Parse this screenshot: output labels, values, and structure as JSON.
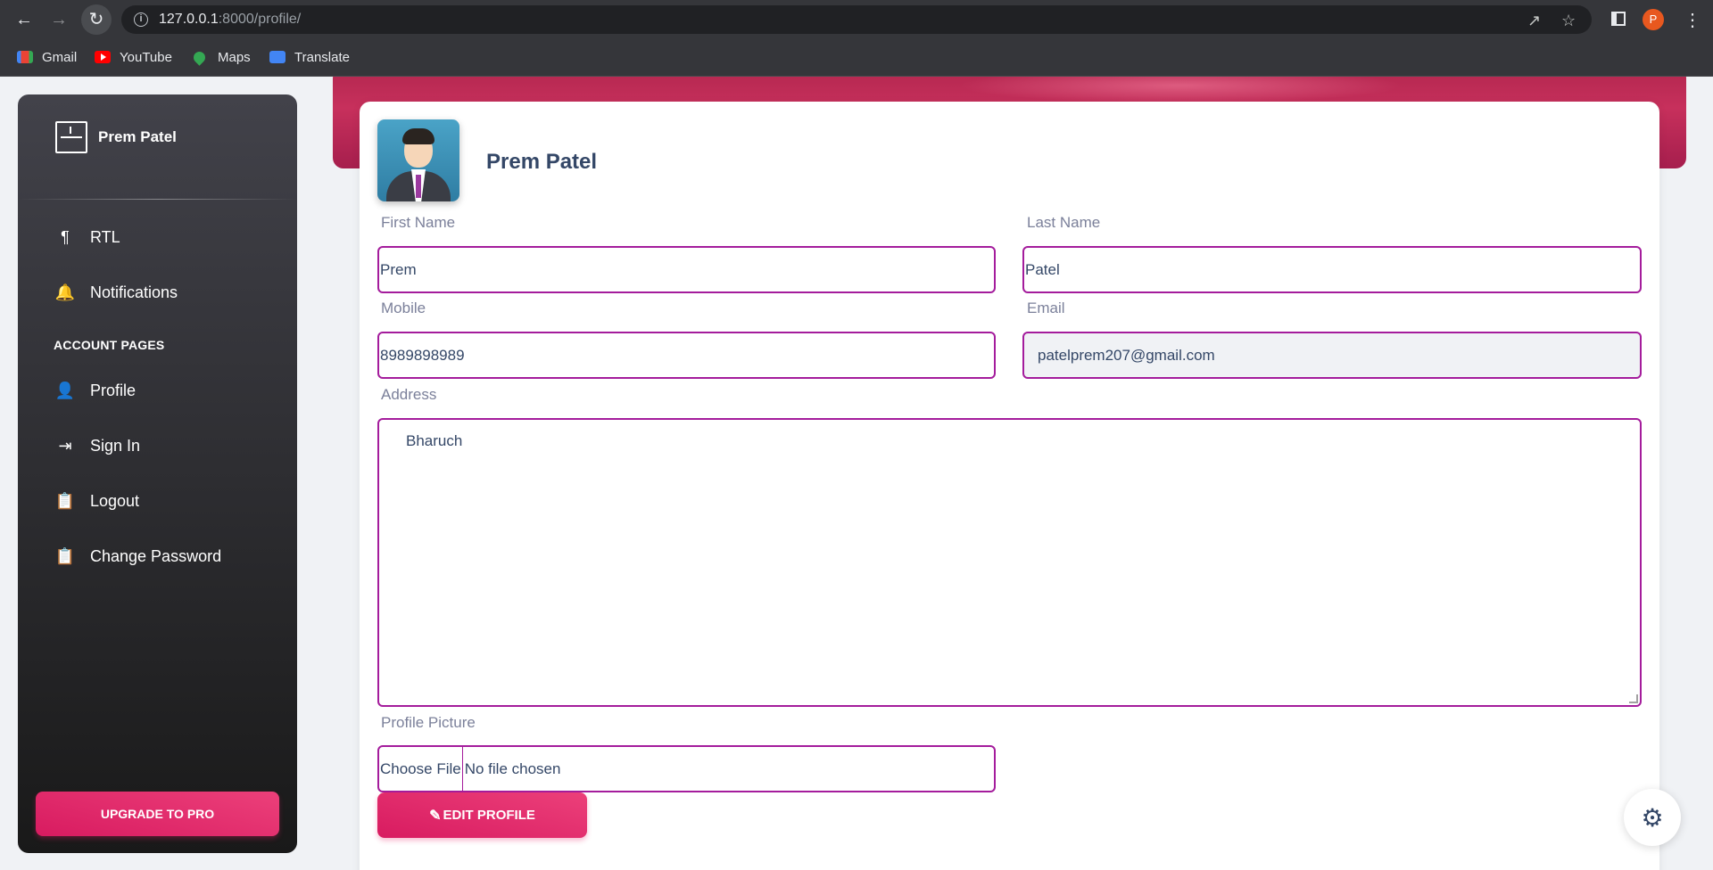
{
  "browser": {
    "url_host": "127.0.0.1",
    "url_rest": ":8000/profile/",
    "profile_initial": "P",
    "bookmarks": [
      {
        "label": "Gmail",
        "icon": "gmail-icon"
      },
      {
        "label": "YouTube",
        "icon": "youtube-icon"
      },
      {
        "label": "Maps",
        "icon": "maps-icon"
      },
      {
        "label": "Translate",
        "icon": "translate-icon"
      }
    ]
  },
  "sidebar": {
    "brand": "Prem Patel",
    "items": [
      {
        "label": "RTL",
        "icon": "rtl-icon"
      },
      {
        "label": "Notifications",
        "icon": "bell-icon"
      }
    ],
    "section_title": "ACCOUNT PAGES",
    "account_items": [
      {
        "label": "Profile",
        "icon": "person-icon"
      },
      {
        "label": "Sign In",
        "icon": "login-icon"
      },
      {
        "label": "Logout",
        "icon": "clipboard-icon"
      },
      {
        "label": "Change Password",
        "icon": "clipboard-icon"
      }
    ],
    "upgrade_label": "UPGRADE TO PRO"
  },
  "profile": {
    "name": "Prem Patel",
    "fields": {
      "first_name": {
        "label": "First Name",
        "value": "Prem"
      },
      "last_name": {
        "label": "Last Name",
        "value": "Patel"
      },
      "mobile": {
        "label": "Mobile",
        "value": "8989898989"
      },
      "email": {
        "label": "Email",
        "value": "patelprem207@gmail.com"
      },
      "address": {
        "label": "Address",
        "value": "Bharuch"
      },
      "picture": {
        "label": "Profile Picture",
        "button": "Choose File",
        "status": "No file chosen"
      }
    },
    "edit_label": "EDIT PROFILE"
  },
  "colors": {
    "accent": "#e91e63",
    "input_border": "#a41c9c",
    "sidebar_dark": "#191919"
  }
}
